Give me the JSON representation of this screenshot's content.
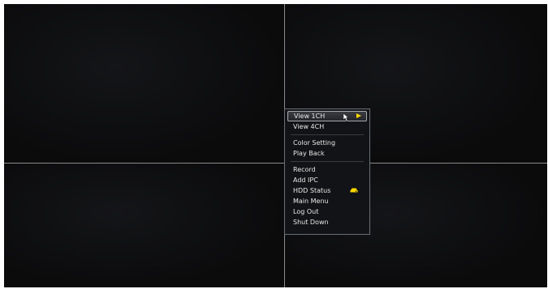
{
  "menu": {
    "items": [
      {
        "label": "View 1CH"
      },
      {
        "label": "View 4CH"
      },
      {
        "label": "Color Setting"
      },
      {
        "label": "Play Back"
      },
      {
        "label": "Record"
      },
      {
        "label": "Add IPC"
      },
      {
        "label": "HDD Status"
      },
      {
        "label": "Main Menu"
      },
      {
        "label": "Log Out"
      },
      {
        "label": "Shut Down"
      }
    ],
    "selected_index": 0,
    "submenu_arrow_icon": "triangle-right-icon",
    "hdd_icon": "hdd-warning-icon"
  },
  "colors": {
    "background": "#0c0c0d",
    "grid_line": "#8a8a8a",
    "accent": "#ffd900"
  }
}
